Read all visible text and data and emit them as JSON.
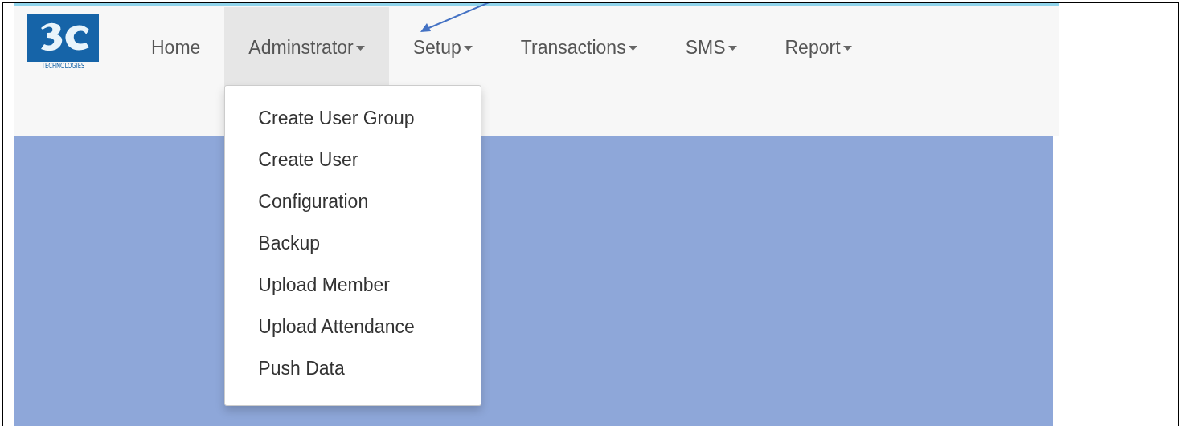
{
  "logo": {
    "caption": "TECHNOLOGIES"
  },
  "nav": [
    {
      "label": "Home",
      "dropdown": false,
      "selected": false
    },
    {
      "label": "Adminstrator",
      "dropdown": true,
      "selected": true
    },
    {
      "label": "Setup",
      "dropdown": true,
      "selected": false
    },
    {
      "label": "Transactions",
      "dropdown": true,
      "selected": false
    },
    {
      "label": "SMS",
      "dropdown": true,
      "selected": false
    },
    {
      "label": "Report",
      "dropdown": true,
      "selected": false
    }
  ],
  "menu": [
    "Create User Group",
    "Create User",
    "Configuration",
    "Backup",
    "Upload Member",
    "Upload Attendance",
    "Push Data"
  ]
}
